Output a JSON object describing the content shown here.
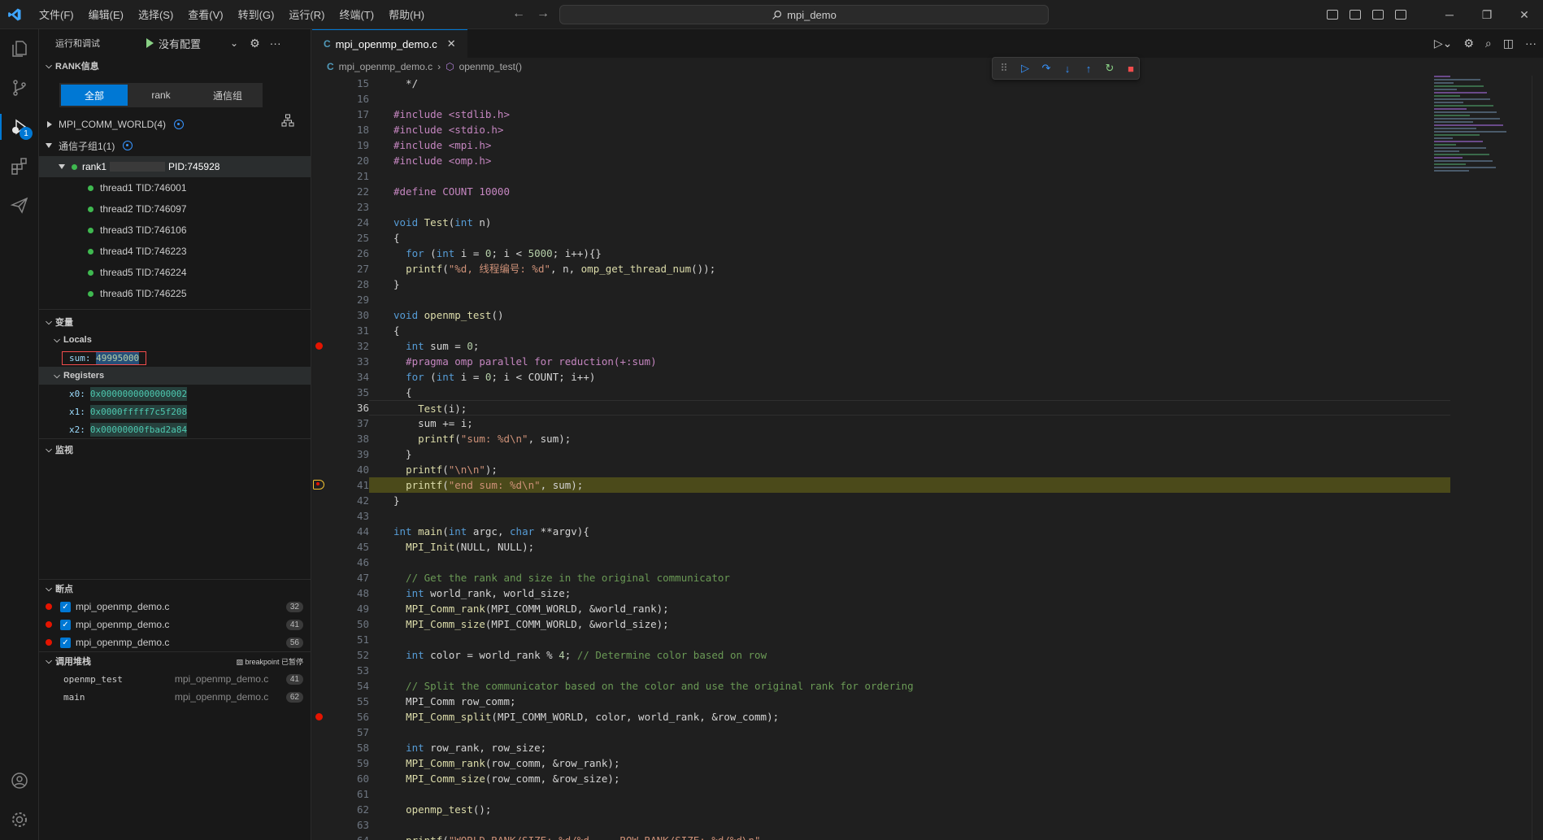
{
  "title_bar": {
    "menu": [
      "文件(F)",
      "编辑(E)",
      "选择(S)",
      "查看(V)",
      "转到(G)",
      "运行(R)",
      "终端(T)",
      "帮助(H)"
    ],
    "search_text": "mpi_demo"
  },
  "activity": {
    "debug_badge": "1"
  },
  "sidebar": {
    "header_title": "运行和调试",
    "run_config": "没有配置",
    "rank_section": "RANK信息",
    "tabs": [
      "全部",
      "rank",
      "通信组"
    ],
    "comm_world": "MPI_COMM_WORLD(4)",
    "comm_sub": "通信子组1(1)",
    "rank_label": "rank1",
    "pid": "PID:745928",
    "threads": [
      "thread1 TID:746001",
      "thread2 TID:746097",
      "thread3 TID:746106",
      "thread4 TID:746223",
      "thread5 TID:746224",
      "thread6 TID:746225"
    ],
    "variables_section": "变量",
    "locals_label": "Locals",
    "sum_name": "sum:",
    "sum_value": "49995000",
    "registers_label": "Registers",
    "registers": [
      {
        "name": "x0:",
        "value": "0x0000000000000002"
      },
      {
        "name": "x1:",
        "value": "0x0000fffff7c5f208"
      },
      {
        "name": "x2:",
        "value": "0x00000000fbad2a84"
      }
    ],
    "watch_section": "监视",
    "breakpoints_section": "断点",
    "breakpoints": [
      {
        "file": "mpi_openmp_demo.c",
        "line": "32"
      },
      {
        "file": "mpi_openmp_demo.c",
        "line": "41"
      },
      {
        "file": "mpi_openmp_demo.c",
        "line": "56"
      }
    ],
    "callstack_section": "调用堆栈",
    "callstack_status": "breakpoint 已暂停",
    "callstack": [
      {
        "fn": "openmp_test",
        "file": "mpi_openmp_demo.c",
        "line": "41"
      },
      {
        "fn": "main",
        "file": "mpi_openmp_demo.c",
        "line": "62"
      }
    ]
  },
  "editor": {
    "tab_name": "mpi_openmp_demo.c",
    "breadcrumb_file": "mpi_openmp_demo.c",
    "breadcrumb_fn": "openmp_test()",
    "lines": [
      {
        "n": "15",
        "t": "  */"
      },
      {
        "n": "16",
        "t": ""
      },
      {
        "n": "17",
        "t": "#include <stdlib.h>"
      },
      {
        "n": "18",
        "t": "#include <stdio.h>"
      },
      {
        "n": "19",
        "t": "#include <mpi.h>"
      },
      {
        "n": "20",
        "t": "#include <omp.h>"
      },
      {
        "n": "21",
        "t": ""
      },
      {
        "n": "22",
        "t": "#define COUNT 10000"
      },
      {
        "n": "23",
        "t": ""
      },
      {
        "n": "24",
        "t": "void Test(int n)"
      },
      {
        "n": "25",
        "t": "{"
      },
      {
        "n": "26",
        "t": "  for (int i = 0; i < 5000; i++){}"
      },
      {
        "n": "27",
        "t": "  printf(\"%d, 线程编号: %d\", n, omp_get_thread_num());"
      },
      {
        "n": "28",
        "t": "}"
      },
      {
        "n": "29",
        "t": ""
      },
      {
        "n": "30",
        "t": "void openmp_test()"
      },
      {
        "n": "31",
        "t": "{"
      },
      {
        "n": "32",
        "t": "  int sum = 0;"
      },
      {
        "n": "33",
        "t": "  #pragma omp parallel for reduction(+:sum)"
      },
      {
        "n": "34",
        "t": "  for (int i = 0; i < COUNT; i++)"
      },
      {
        "n": "35",
        "t": "  {"
      },
      {
        "n": "36",
        "t": "    Test(i);"
      },
      {
        "n": "37",
        "t": "    sum += i;"
      },
      {
        "n": "38",
        "t": "    printf(\"sum: %d\\n\", sum);"
      },
      {
        "n": "39",
        "t": "  }"
      },
      {
        "n": "40",
        "t": "  printf(\"\\n\\n\");"
      },
      {
        "n": "41",
        "t": "  printf(\"end sum: %d\\n\", sum);"
      },
      {
        "n": "42",
        "t": "}"
      },
      {
        "n": "43",
        "t": ""
      },
      {
        "n": "44",
        "t": "int main(int argc, char **argv){"
      },
      {
        "n": "45",
        "t": "  MPI_Init(NULL, NULL);"
      },
      {
        "n": "46",
        "t": ""
      },
      {
        "n": "47",
        "t": "  // Get the rank and size in the original communicator"
      },
      {
        "n": "48",
        "t": "  int world_rank, world_size;"
      },
      {
        "n": "49",
        "t": "  MPI_Comm_rank(MPI_COMM_WORLD, &world_rank);"
      },
      {
        "n": "50",
        "t": "  MPI_Comm_size(MPI_COMM_WORLD, &world_size);"
      },
      {
        "n": "51",
        "t": ""
      },
      {
        "n": "52",
        "t": "  int color = world_rank % 4; // Determine color based on row"
      },
      {
        "n": "53",
        "t": ""
      },
      {
        "n": "54",
        "t": "  // Split the communicator based on the color and use the original rank for ordering"
      },
      {
        "n": "55",
        "t": "  MPI_Comm row_comm;"
      },
      {
        "n": "56",
        "t": "  MPI_Comm_split(MPI_COMM_WORLD, color, world_rank, &row_comm);"
      },
      {
        "n": "57",
        "t": ""
      },
      {
        "n": "58",
        "t": "  int row_rank, row_size;"
      },
      {
        "n": "59",
        "t": "  MPI_Comm_rank(row_comm, &row_rank);"
      },
      {
        "n": "60",
        "t": "  MPI_Comm_size(row_comm, &row_size);"
      },
      {
        "n": "61",
        "t": ""
      },
      {
        "n": "62",
        "t": "  openmp_test();"
      },
      {
        "n": "63",
        "t": ""
      },
      {
        "n": "64",
        "t": "  printf(\"WORLD RANK/SIZE: %d/%d --- ROW RANK/SIZE: %d/%d\\n\","
      }
    ],
    "breakpoint_lines": [
      "32",
      "56"
    ],
    "paused_line": "41",
    "current_line": "36"
  },
  "colors": {
    "accent": "#0078d4",
    "breakpoint": "#e51400",
    "running": "#3fb950",
    "paused_highlight": "#4b4a1a"
  }
}
